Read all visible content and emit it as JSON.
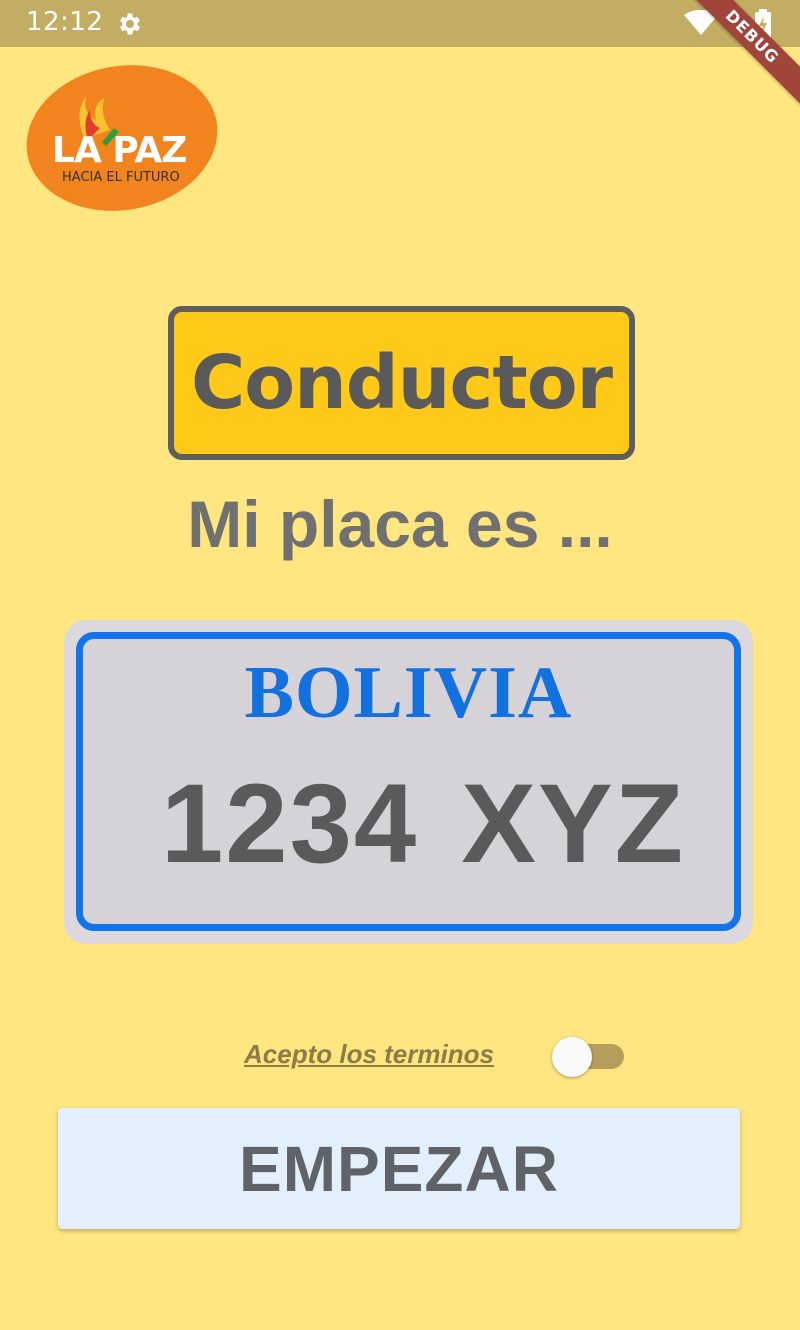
{
  "status_bar": {
    "time": "12:12",
    "icons": [
      "gear-icon",
      "wifi-icon",
      "battery-charging-icon"
    ]
  },
  "debug_banner": "DEBUG",
  "logo": {
    "title": "LA PAZ",
    "subtitle": "HACIA EL FUTURO",
    "color": "#F2841F"
  },
  "role": {
    "label": "Conductor",
    "background": "#FFC919"
  },
  "heading": "Mi placa es ...",
  "plate": {
    "country": "BOLIVIA",
    "number": "1234 XYZ",
    "border_color": "#1274E8"
  },
  "terms": {
    "label": "Acepto los terminos",
    "accepted": false
  },
  "start_button": {
    "label": "EMPEZAR"
  },
  "colors": {
    "background": "#FFE680",
    "status_bar": "#C2AD62"
  }
}
